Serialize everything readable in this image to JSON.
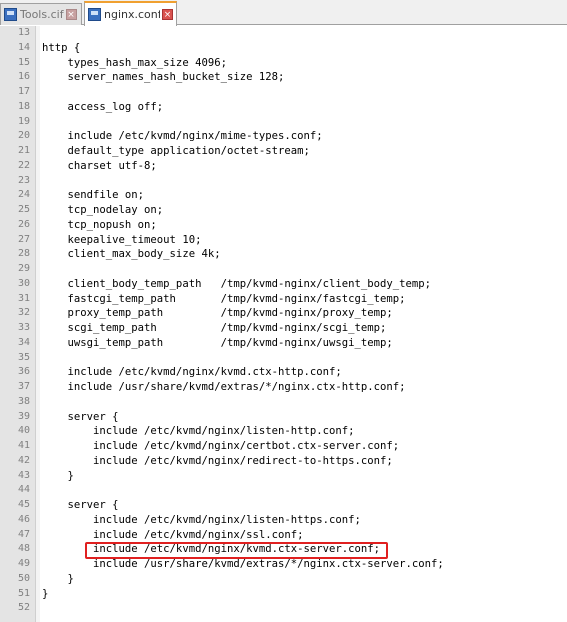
{
  "tabs": [
    {
      "label": "Tools.cif",
      "active": false
    },
    {
      "label": "nginx.conf",
      "active": true
    }
  ],
  "editor": {
    "lines": [
      {
        "num": "13",
        "text": ""
      },
      {
        "num": "14",
        "text": "http {"
      },
      {
        "num": "15",
        "text": "    types_hash_max_size 4096;"
      },
      {
        "num": "16",
        "text": "    server_names_hash_bucket_size 128;"
      },
      {
        "num": "17",
        "text": ""
      },
      {
        "num": "18",
        "text": "    access_log off;"
      },
      {
        "num": "19",
        "text": ""
      },
      {
        "num": "20",
        "text": "    include /etc/kvmd/nginx/mime-types.conf;"
      },
      {
        "num": "21",
        "text": "    default_type application/octet-stream;"
      },
      {
        "num": "22",
        "text": "    charset utf-8;"
      },
      {
        "num": "23",
        "text": ""
      },
      {
        "num": "24",
        "text": "    sendfile on;"
      },
      {
        "num": "25",
        "text": "    tcp_nodelay on;"
      },
      {
        "num": "26",
        "text": "    tcp_nopush on;"
      },
      {
        "num": "27",
        "text": "    keepalive_timeout 10;"
      },
      {
        "num": "28",
        "text": "    client_max_body_size 4k;"
      },
      {
        "num": "29",
        "text": ""
      },
      {
        "num": "30",
        "text": "    client_body_temp_path   /tmp/kvmd-nginx/client_body_temp;"
      },
      {
        "num": "31",
        "text": "    fastcgi_temp_path       /tmp/kvmd-nginx/fastcgi_temp;"
      },
      {
        "num": "32",
        "text": "    proxy_temp_path         /tmp/kvmd-nginx/proxy_temp;"
      },
      {
        "num": "33",
        "text": "    scgi_temp_path          /tmp/kvmd-nginx/scgi_temp;"
      },
      {
        "num": "34",
        "text": "    uwsgi_temp_path         /tmp/kvmd-nginx/uwsgi_temp;"
      },
      {
        "num": "35",
        "text": ""
      },
      {
        "num": "36",
        "text": "    include /etc/kvmd/nginx/kvmd.ctx-http.conf;"
      },
      {
        "num": "37",
        "text": "    include /usr/share/kvmd/extras/*/nginx.ctx-http.conf;"
      },
      {
        "num": "38",
        "text": ""
      },
      {
        "num": "39",
        "text": "    server {"
      },
      {
        "num": "40",
        "text": "        include /etc/kvmd/nginx/listen-http.conf;"
      },
      {
        "num": "41",
        "text": "        include /etc/kvmd/nginx/certbot.ctx-server.conf;"
      },
      {
        "num": "42",
        "text": "        include /etc/kvmd/nginx/redirect-to-https.conf;"
      },
      {
        "num": "43",
        "text": "    }"
      },
      {
        "num": "44",
        "text": ""
      },
      {
        "num": "45",
        "text": "    server {"
      },
      {
        "num": "46",
        "text": "        include /etc/kvmd/nginx/listen-https.conf;"
      },
      {
        "num": "47",
        "text": "        include /etc/kvmd/nginx/ssl.conf;"
      },
      {
        "num": "48",
        "text": "        include /etc/kvmd/nginx/kvmd.ctx-server.conf;"
      },
      {
        "num": "49",
        "text": "        include /usr/share/kvmd/extras/*/nginx.ctx-server.conf;"
      },
      {
        "num": "50",
        "text": "    }"
      },
      {
        "num": "51",
        "text": "}"
      },
      {
        "num": "52",
        "text": ""
      }
    ]
  },
  "colors": {
    "highlight_border": "#e02020",
    "gutter_bg": "#e4e4e4",
    "active_tab_accent": "#f0a030"
  }
}
